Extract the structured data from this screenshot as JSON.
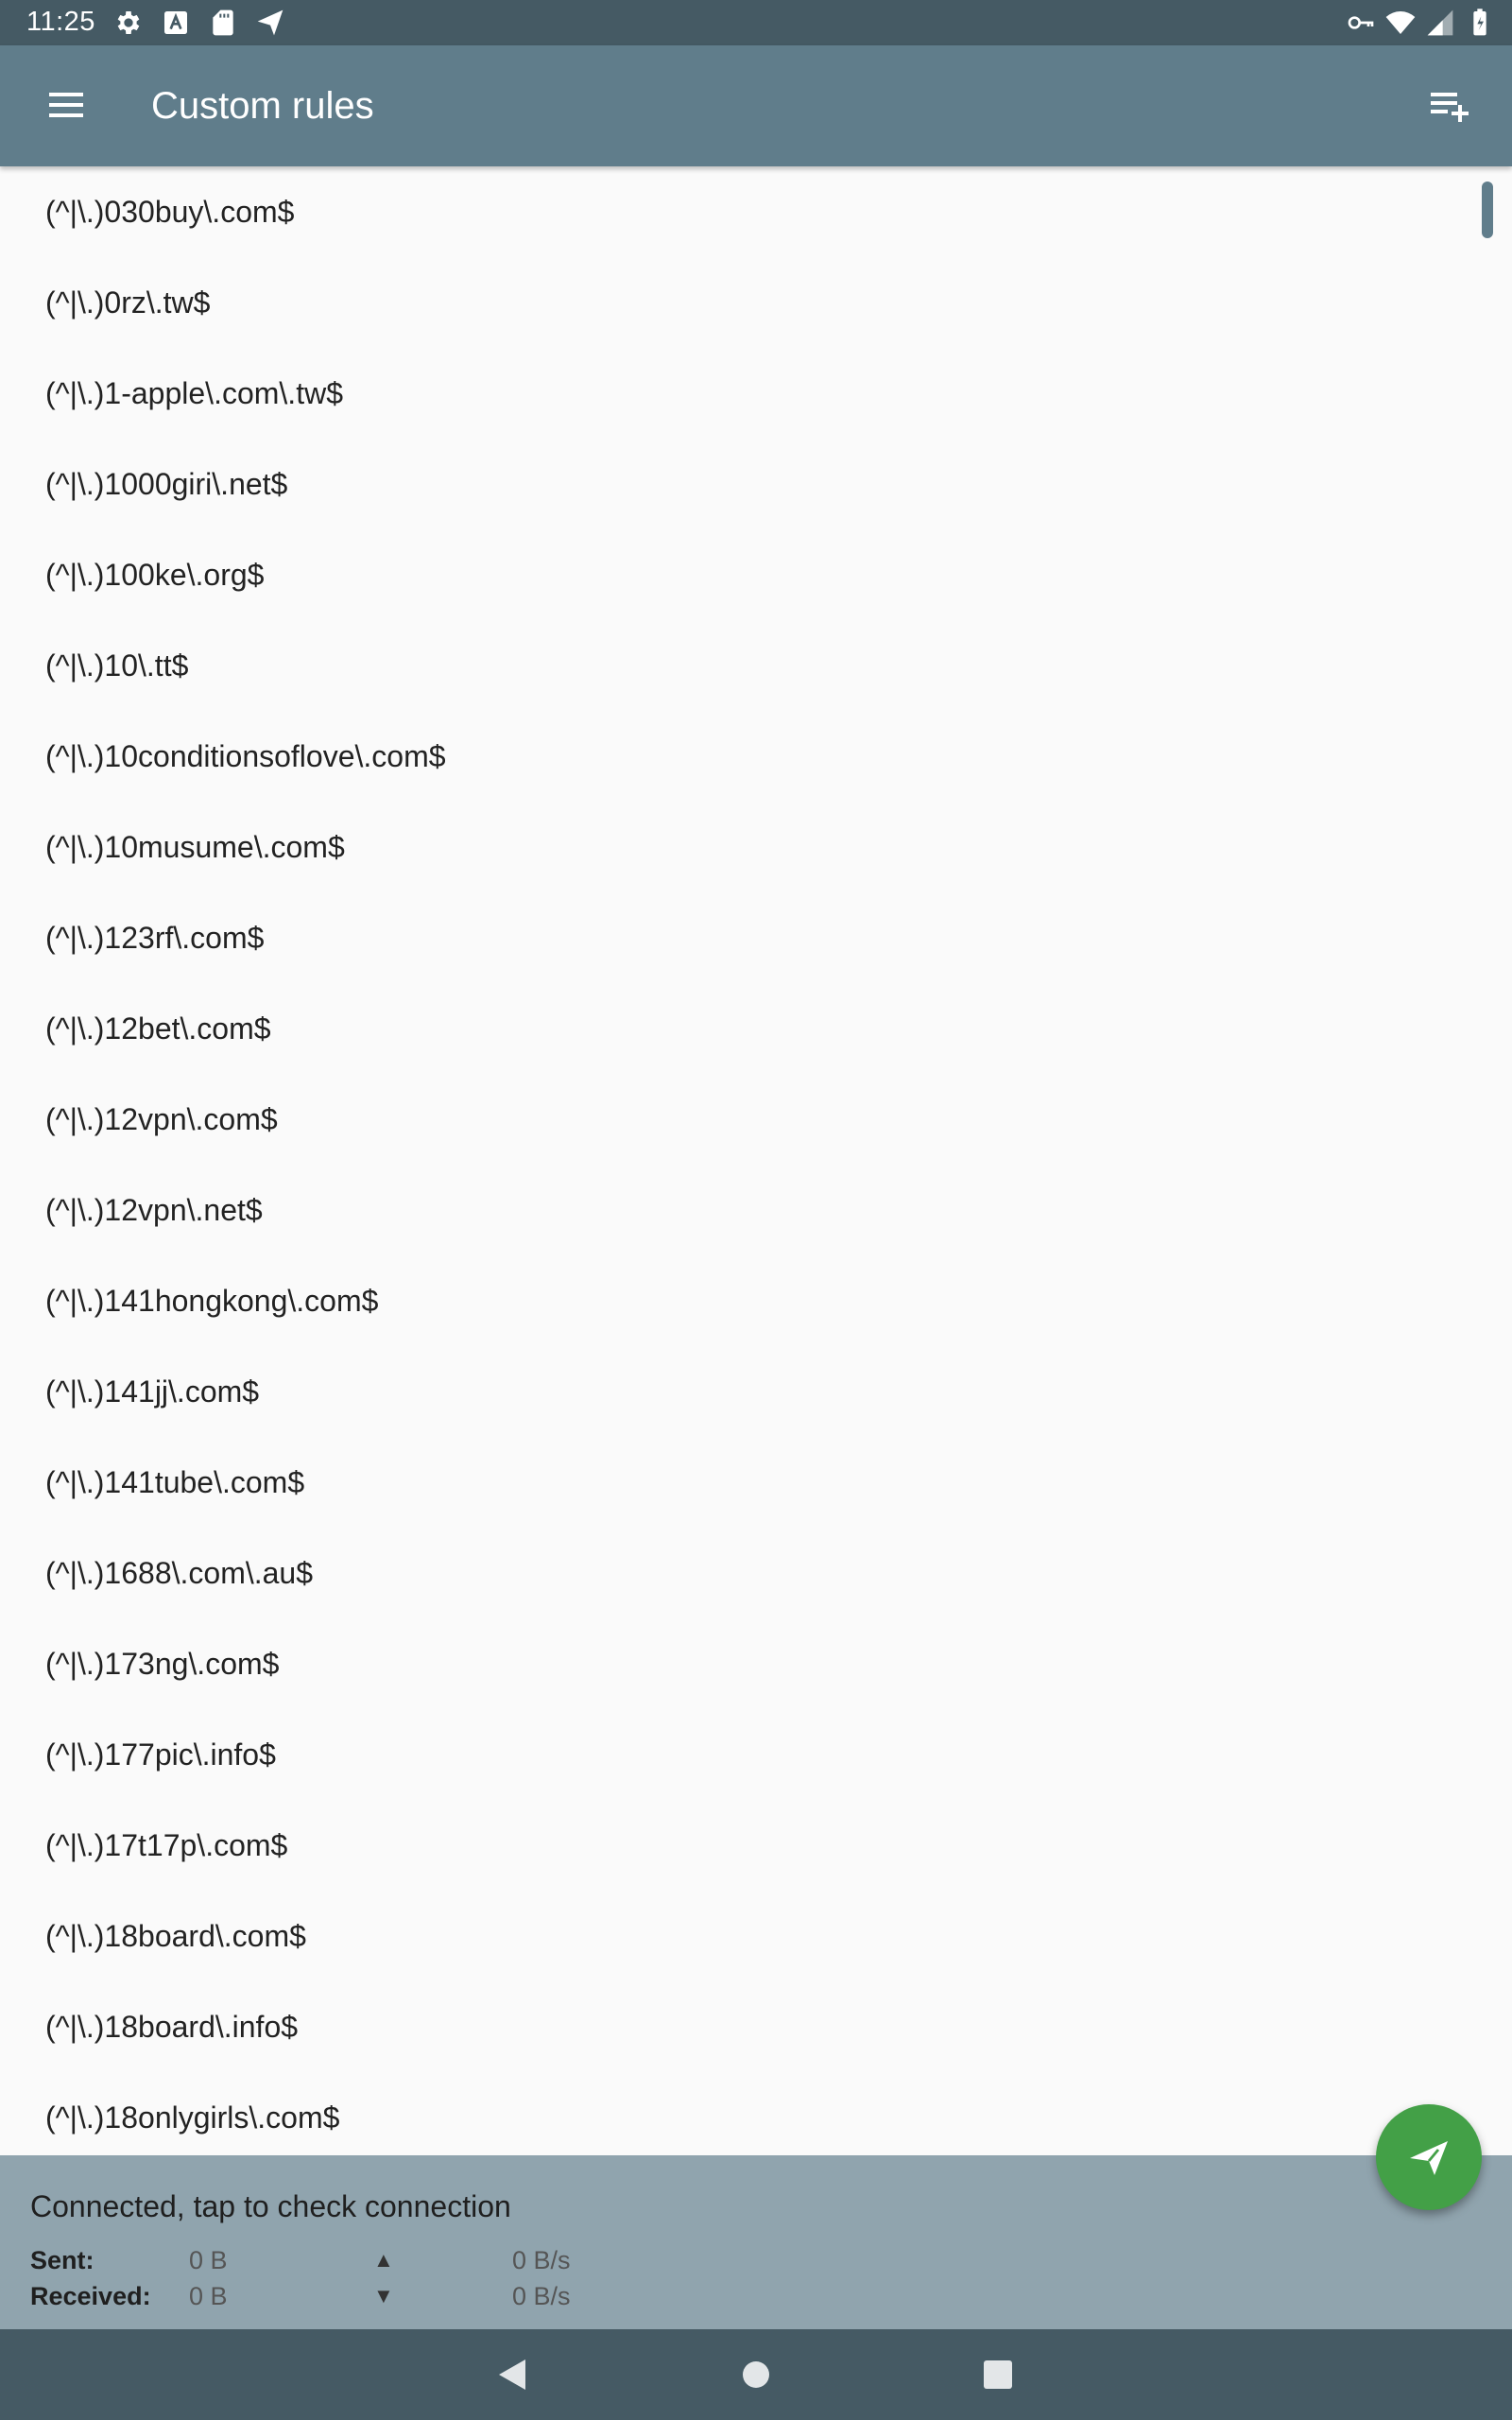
{
  "status_bar": {
    "time": "11:25",
    "left_icons": [
      "gear-icon",
      "font-icon",
      "sd-card-icon",
      "send-icon"
    ],
    "right_icons": [
      "vpn-key-icon",
      "wifi-icon",
      "signal-icon",
      "battery-charging-icon"
    ]
  },
  "app_bar": {
    "title": "Custom rules",
    "menu_icon": "menu-icon",
    "action_icon": "playlist-add-icon"
  },
  "rules": [
    "(^|\\.)030buy\\.com$",
    "(^|\\.)0rz\\.tw$",
    "(^|\\.)1-apple\\.com\\.tw$",
    "(^|\\.)1000giri\\.net$",
    "(^|\\.)100ke\\.org$",
    "(^|\\.)10\\.tt$",
    "(^|\\.)10conditionsoflove\\.com$",
    "(^|\\.)10musume\\.com$",
    "(^|\\.)123rf\\.com$",
    "(^|\\.)12bet\\.com$",
    "(^|\\.)12vpn\\.com$",
    "(^|\\.)12vpn\\.net$",
    "(^|\\.)141hongkong\\.com$",
    "(^|\\.)141jj\\.com$",
    "(^|\\.)141tube\\.com$",
    "(^|\\.)1688\\.com\\.au$",
    "(^|\\.)173ng\\.com$",
    "(^|\\.)177pic\\.info$",
    "(^|\\.)17t17p\\.com$",
    "(^|\\.)18board\\.com$",
    "(^|\\.)18board\\.info$",
    "(^|\\.)18onlygirls\\.com$"
  ],
  "fab": {
    "icon": "send-icon"
  },
  "connection": {
    "status": "Connected, tap to check connection",
    "sent_label": "Sent:",
    "sent_value": "0 B",
    "sent_arrow": "▲",
    "sent_rate": "0 B/s",
    "received_label": "Received:",
    "received_value": "0 B",
    "received_arrow": "▼",
    "received_rate": "0 B/s"
  },
  "nav_bar": {
    "icons": [
      "back-icon",
      "home-icon",
      "recents-icon"
    ]
  },
  "colors": {
    "status_bar": "#455a64",
    "app_bar": "#607d8b",
    "connection_panel": "#90a4ae",
    "fab": "#43a047",
    "nav_bar": "#455a64"
  }
}
